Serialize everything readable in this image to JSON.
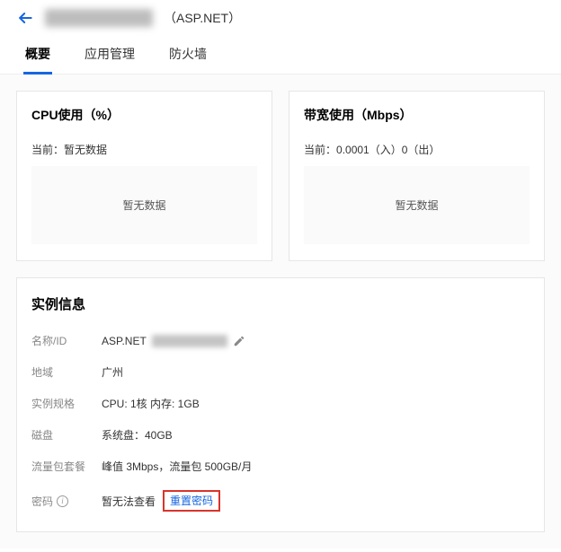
{
  "header": {
    "subtitle": "（ASP.NET）"
  },
  "tabs": {
    "overview": "概要",
    "apps": "应用管理",
    "firewall": "防火墙"
  },
  "cpu_panel": {
    "title": "CPU使用（%）",
    "current_label": "当前：",
    "current_value": "暂无数据",
    "nodata": "暂无数据"
  },
  "bw_panel": {
    "title": "带宽使用（Mbps）",
    "current_label": "当前：",
    "current_value": "0.0001（入）0（出）",
    "nodata": "暂无数据"
  },
  "info": {
    "title": "实例信息",
    "name_label": "名称/ID",
    "name_prefix": "ASP.NET",
    "region_label": "地域",
    "region_value": "广州",
    "spec_label": "实例规格",
    "spec_value": "CPU: 1核 内存: 1GB",
    "disk_label": "磁盘",
    "disk_value": "系统盘：40GB",
    "traffic_label": "流量包套餐",
    "traffic_value": "峰值 3Mbps，流量包 500GB/月",
    "pwd_label": "密码",
    "pwd_value": "暂无法查看",
    "pwd_reset": "重置密码"
  }
}
